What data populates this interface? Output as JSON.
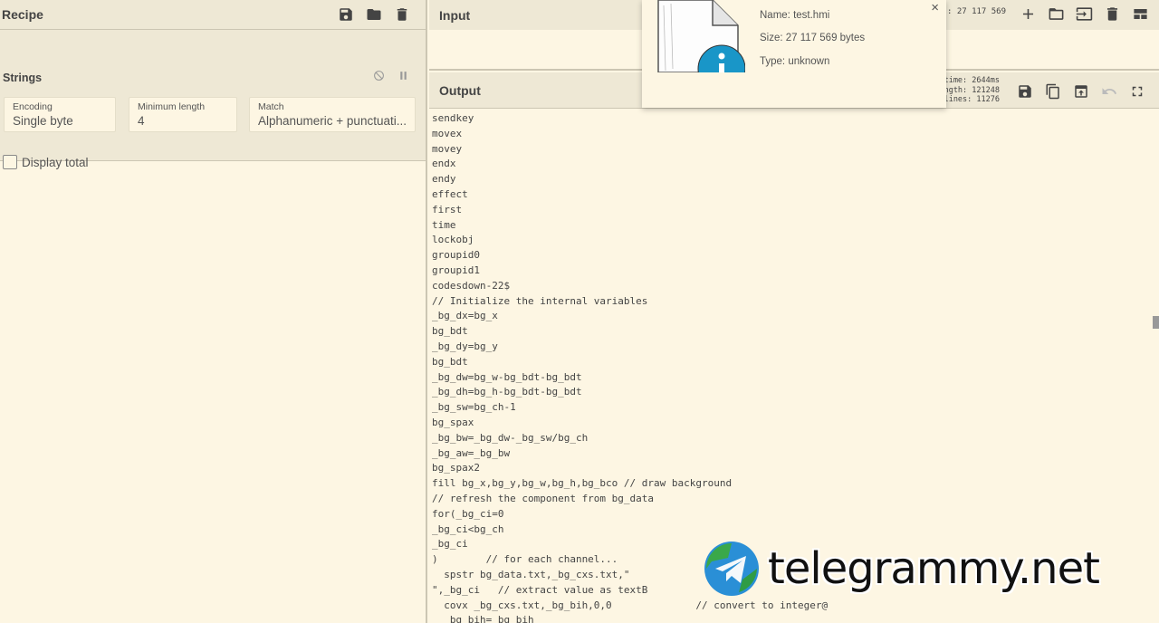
{
  "recipe": {
    "title": "Recipe",
    "operation": {
      "name": "Strings",
      "fields": [
        {
          "label": "Encoding",
          "value": "Single byte"
        },
        {
          "label": "Minimum length",
          "value": "4"
        },
        {
          "label": "Match",
          "value": "Alphanumeric + punctuati..."
        }
      ],
      "checkbox_label": "Display total"
    }
  },
  "input": {
    "title": "Input",
    "stats": ": 27 117 569"
  },
  "file_popup": {
    "name": "Name: test.hmi",
    "size": "Size: 27 117 569 bytes",
    "type": "Type: unknown",
    "close": "×"
  },
  "output": {
    "title": "Output",
    "stats": {
      "time": "time: 2644ms",
      "length": "length: 121248",
      "lines": "lines:  11276"
    },
    "lines": [
      "sendkey",
      "movex",
      "movey",
      "endx",
      "endy",
      "effect",
      "first",
      "time",
      "lockobj",
      "groupid0",
      "groupid1",
      "codesdown-22$",
      "// Initialize the internal variables",
      "_bg_dx=bg_x",
      "bg_bdt",
      "_bg_dy=bg_y",
      "bg_bdt",
      "_bg_dw=bg_w-bg_bdt-bg_bdt",
      "_bg_dh=bg_h-bg_bdt-bg_bdt",
      "_bg_sw=bg_ch-1",
      "bg_spax",
      "_bg_bw=_bg_dw-_bg_sw/bg_ch",
      "_bg_aw=_bg_bw",
      "bg_spax2",
      "fill bg_x,bg_y,bg_w,bg_h,bg_bco // draw background",
      "// refresh the component from bg_data",
      "for(_bg_ci=0",
      "_bg_ci<bg_ch",
      "_bg_ci",
      ")        // for each channel...",
      "  spstr bg_data.txt,_bg_cxs.txt,\"",
      "\",_bg_ci   // extract value as textB",
      "  covx _bg_cxs.txt,_bg_bih,0,0              // convert to integer@",
      "  _bg_bih=_bg_bih"
    ]
  },
  "watermark": {
    "text": "telegrammy.net"
  }
}
